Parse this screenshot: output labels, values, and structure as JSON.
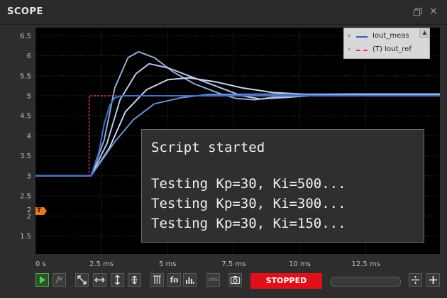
{
  "window": {
    "title": "SCOPE",
    "restore_icon": "restore-icon",
    "close_icon": "close-icon"
  },
  "console": {
    "lines": [
      "Script started",
      "",
      "Testing Kp=30, Ki=500...",
      "Testing Kp=30, Ki=300...",
      "Testing Kp=30, Ki=150..."
    ]
  },
  "legend": {
    "entries": [
      {
        "label": "Iout_meas",
        "color": "#3060c0",
        "style": "solid"
      },
      {
        "label": "(T) Iout_ref",
        "color": "#e0307a",
        "style": "dashed"
      }
    ]
  },
  "trigger": {
    "marker": "T",
    "level_label": "2"
  },
  "status": {
    "label": "STOPPED",
    "color": "#e0101a"
  },
  "toolbar": {
    "buttons": [
      {
        "name": "run-button",
        "icon": "play-icon"
      },
      {
        "name": "single-shot-button",
        "icon": "single-shot-icon"
      },
      {
        "name": "zoom-fit-button",
        "icon": "diagonal-arrows-icon"
      },
      {
        "name": "zoom-horizontal-button",
        "icon": "horizontal-arrows-icon"
      },
      {
        "name": "zoom-vertical-button",
        "icon": "vertical-arrows-icon"
      },
      {
        "name": "autoscale-y-button",
        "icon": "vertical-arrow-bar-icon"
      },
      {
        "name": "measurement-button",
        "icon": "measure-icon"
      },
      {
        "name": "fft-button",
        "icon": "fo-icon"
      },
      {
        "name": "histogram-button",
        "icon": "bar-chart-icon"
      },
      {
        "name": "ovs-button",
        "icon": "ovs-icon"
      },
      {
        "name": "snapshot-button",
        "icon": "camera-icon"
      },
      {
        "name": "decrease-button",
        "icon": "divide-icon"
      },
      {
        "name": "increase-button",
        "icon": "plus-icon"
      }
    ],
    "ovs_label": "OVS",
    "fft_label": "fo"
  },
  "chart_data": {
    "type": "line",
    "title": "",
    "xlabel": "",
    "ylabel": "",
    "grid": true,
    "legend_position": "top-right",
    "xlim": [
      0,
      15.3
    ],
    "ylim": [
      1.05,
      6.7
    ],
    "x_ticks": [
      {
        "value": 0,
        "label": "0 s"
      },
      {
        "value": 2.5,
        "label": "2.5 ms"
      },
      {
        "value": 5,
        "label": "5 ms"
      },
      {
        "value": 7.5,
        "label": "7.5 ms"
      },
      {
        "value": 10,
        "label": "10 ms"
      },
      {
        "value": 12.5,
        "label": "12.5 ms"
      }
    ],
    "y_ticks": [
      {
        "value": 1.5,
        "label": "1.5"
      },
      {
        "value": 2,
        "label": "2"
      },
      {
        "value": 2.5,
        "label": "2.5"
      },
      {
        "value": 3,
        "label": "3"
      },
      {
        "value": 3.5,
        "label": "3.5"
      },
      {
        "value": 4,
        "label": "4"
      },
      {
        "value": 4.5,
        "label": "4.5"
      },
      {
        "value": 5,
        "label": "5"
      },
      {
        "value": 5.5,
        "label": "5.5"
      },
      {
        "value": 6,
        "label": "6"
      },
      {
        "value": 6.5,
        "label": "6.5"
      }
    ],
    "series": [
      {
        "name": "(T) Iout_ref",
        "color": "#e0307a",
        "dashed": true,
        "points": [
          [
            0,
            3
          ],
          [
            2.03,
            3
          ],
          [
            2.03,
            5
          ],
          [
            15.3,
            5
          ]
        ]
      },
      {
        "color": "#8ea9d8",
        "points": [
          [
            0,
            3
          ],
          [
            2.1,
            3
          ],
          [
            2.6,
            3.9
          ],
          [
            3.0,
            5.2
          ],
          [
            3.5,
            5.95
          ],
          [
            3.9,
            6.1
          ],
          [
            4.5,
            5.95
          ],
          [
            5.2,
            5.6
          ],
          [
            6.0,
            5.3
          ],
          [
            7.0,
            5.05
          ],
          [
            7.6,
            4.93
          ],
          [
            8.3,
            4.9
          ],
          [
            9.2,
            4.98
          ],
          [
            10.5,
            5.03
          ],
          [
            12.0,
            5.02
          ],
          [
            15.3,
            5.02
          ]
        ]
      },
      {
        "color": "#b5c8ea",
        "points": [
          [
            0,
            3
          ],
          [
            2.1,
            3
          ],
          [
            2.7,
            3.8
          ],
          [
            3.2,
            4.9
          ],
          [
            3.8,
            5.55
          ],
          [
            4.3,
            5.8
          ],
          [
            5.0,
            5.7
          ],
          [
            5.8,
            5.5
          ],
          [
            6.8,
            5.25
          ],
          [
            7.8,
            5.0
          ],
          [
            8.5,
            4.92
          ],
          [
            9.5,
            4.96
          ],
          [
            11.0,
            5.03
          ],
          [
            13.0,
            5.02
          ],
          [
            15.3,
            5.02
          ]
        ]
      },
      {
        "color": "#c8d6f0",
        "points": [
          [
            0,
            3
          ],
          [
            2.1,
            3
          ],
          [
            2.8,
            3.7
          ],
          [
            3.4,
            4.6
          ],
          [
            4.2,
            5.15
          ],
          [
            5.0,
            5.4
          ],
          [
            5.8,
            5.45
          ],
          [
            6.8,
            5.35
          ],
          [
            7.8,
            5.2
          ],
          [
            9.0,
            5.08
          ],
          [
            10.5,
            5.03
          ],
          [
            12.5,
            5.04
          ],
          [
            15.3,
            5.04
          ]
        ]
      },
      {
        "color": "#6f8fcf",
        "points": [
          [
            0,
            3
          ],
          [
            2.1,
            3
          ],
          [
            3.0,
            3.85
          ],
          [
            3.7,
            4.4
          ],
          [
            4.5,
            4.8
          ],
          [
            5.5,
            4.95
          ],
          [
            6.5,
            5.03
          ],
          [
            8.0,
            5.04
          ],
          [
            10.0,
            5.04
          ],
          [
            12.0,
            5.05
          ],
          [
            15.3,
            5.05
          ]
        ]
      },
      {
        "name": "Iout_meas",
        "color": "#4470c8",
        "points": [
          [
            0,
            3
          ],
          [
            2.1,
            3
          ],
          [
            2.4,
            3.6
          ],
          [
            2.6,
            4.3
          ],
          [
            2.8,
            4.75
          ],
          [
            3.0,
            4.95
          ],
          [
            3.3,
            5.0
          ],
          [
            15.3,
            5.0
          ]
        ]
      }
    ]
  }
}
